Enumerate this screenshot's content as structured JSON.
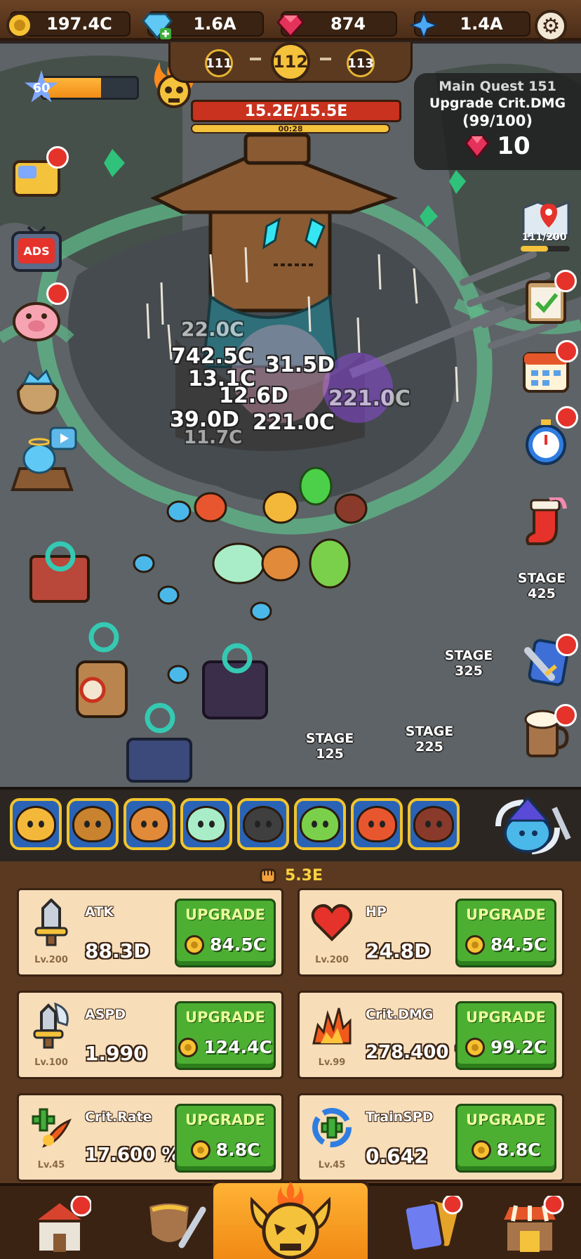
{
  "currencies": {
    "gold": "197.4C",
    "diamond": "1.6A",
    "ruby": "874",
    "crystal": "1.4A"
  },
  "stage": {
    "prev": "111",
    "current": "112",
    "next": "113"
  },
  "player_level": "60",
  "player_level_progress": 0.62,
  "boss": {
    "hp_text": "15.2E/15.5E",
    "hp_fraction": 0.98,
    "timer": "00:28"
  },
  "quest": {
    "title": "Main Quest 151",
    "task": "Upgrade Crit.DMG",
    "progress": "(99/100)",
    "reward": "10"
  },
  "side_left": [
    {
      "name": "ticket-icon"
    },
    {
      "name": "ads-tv-icon",
      "label": "ADS"
    },
    {
      "name": "piggy-bank-icon"
    },
    {
      "name": "gem-sack-icon"
    },
    {
      "name": "angel-shrine-icon"
    }
  ],
  "side_right": {
    "map_progress": "111/200"
  },
  "stage_markers": [
    {
      "label": "STAGE",
      "num": "425"
    },
    {
      "label": "STAGE",
      "num": "325"
    },
    {
      "label": "STAGE",
      "num": "225"
    },
    {
      "label": "STAGE",
      "num": "125"
    }
  ],
  "damage_numbers": [
    "742.5C",
    "13.1C",
    "31.5D",
    "12.6D",
    "39.0D",
    "221.0C",
    "22.0C",
    "11.7C",
    "221.0C"
  ],
  "hero_colors": [
    "#f3b83a",
    "#c9822d",
    "#e08a3a",
    "#a9ecc8",
    "#3f3f3f",
    "#7ad04a",
    "#e7562e",
    "#8a3a2a"
  ],
  "combat_power": "5.3E",
  "upgrades": [
    {
      "name": "ATK",
      "value": "88.3D",
      "level": "Lv.200",
      "btn": "UPGRADE",
      "cost": "84.5C",
      "icon": "sword-icon"
    },
    {
      "name": "HP",
      "value": "24.8D",
      "level": "Lv.200",
      "btn": "UPGRADE",
      "cost": "84.5C",
      "icon": "heart-icon"
    },
    {
      "name": "ASPD",
      "value": "1.990",
      "level": "Lv.100",
      "btn": "UPGRADE",
      "cost": "124.4C",
      "icon": "winged-sword-icon"
    },
    {
      "name": "Crit.DMG",
      "value": "278.400 %",
      "level": "Lv.99",
      "btn": "UPGRADE",
      "cost": "99.2C",
      "icon": "fire-icon"
    },
    {
      "name": "Crit.Rate",
      "value": "17.600 %",
      "level": "Lv.45",
      "btn": "UPGRADE",
      "cost": "8.8C",
      "icon": "crit-rate-icon"
    },
    {
      "name": "TrainSPD",
      "value": "0.642",
      "level": "Lv.45",
      "btn": "UPGRADE",
      "cost": "8.8C",
      "icon": "train-speed-icon"
    }
  ],
  "colors": {
    "upgrade_green": "#4caf32",
    "card_bg": "#f7ddb8",
    "panel_brown": "#5a3920",
    "accent_gold": "#f4c23b",
    "badge_red": "#e5322a"
  }
}
